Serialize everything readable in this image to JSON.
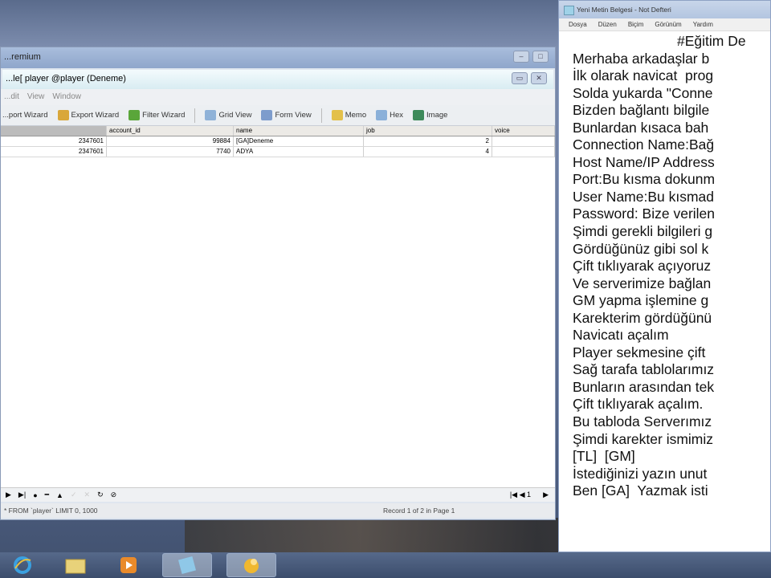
{
  "navicat": {
    "title": "...remium",
    "tab_title": "...le[ player @player (Deneme)",
    "menu": [
      "...dit",
      "View",
      "Window"
    ],
    "toolbar": [
      {
        "label": "...port Wizard",
        "icon": "import-icon"
      },
      {
        "label": "Export Wizard",
        "icon": "export-icon"
      },
      {
        "label": "Filter Wizard",
        "icon": "filter-icon"
      },
      {
        "label": "Grid View",
        "icon": "grid-view-icon"
      },
      {
        "label": "Form View",
        "icon": "form-view-icon"
      },
      {
        "label": "Memo",
        "icon": "memo-icon"
      },
      {
        "label": "Hex",
        "icon": "hex-icon"
      },
      {
        "label": "Image",
        "icon": "image-icon"
      }
    ],
    "columns": [
      "",
      "account_id",
      "name",
      "job",
      "voice"
    ],
    "rows": [
      [
        "2347601",
        "99884",
        "[GA]Deneme",
        "2",
        ""
      ],
      [
        "2347601",
        "7740",
        "ADYA",
        "4",
        ""
      ]
    ],
    "sql": "* FROM `player` LIMIT 0, 1000",
    "record_status": "Record 1 of 2 in Page 1",
    "page": "1"
  },
  "notepad": {
    "title": "Yeni Metin Belgesi - Not Defteri",
    "menu": [
      "Dosya",
      "Düzen",
      "Biçim",
      "Görünüm",
      "Yardım"
    ],
    "lines": [
      "#Eğitim De",
      "Merhaba arkadaşlar b",
      "İlk olarak navicat  prog",
      "Solda yukarda \"Conne",
      "Bizden bağlantı bilgile",
      "Bunlardan kısaca bah",
      "Connection Name:Bağ",
      "Host Name/IP Address",
      "Port:Bu kısma dokunm",
      "User Name:Bu kısmad",
      "Password: Bize verilen",
      "Şimdi gerekli bilgileri g",
      "Gördüğünüz gibi sol k",
      "Çift tıklıyarak açıyoruz",
      "Ve serverimize bağlan",
      "GM yapma işlemine g",
      "Karekterim gördüğünü",
      "Navicatı açalım",
      "Player sekmesine çift",
      "Sağ tarafa tablolarımız",
      "Bunların arasından tek",
      "Çift tıklıyarak açalım.",
      "Bu tabloda Serverımız",
      "Şimdi karekter ismimiz",
      "[TL]  [GM]",
      "İstediğinizi yazın unut",
      "Ben [GA]  Yazmak isti",
      ""
    ]
  },
  "taskbar": [
    "internet-explorer-icon",
    "file-explorer-icon",
    "media-player-icon",
    "notepad-icon",
    "navicat-icon"
  ]
}
